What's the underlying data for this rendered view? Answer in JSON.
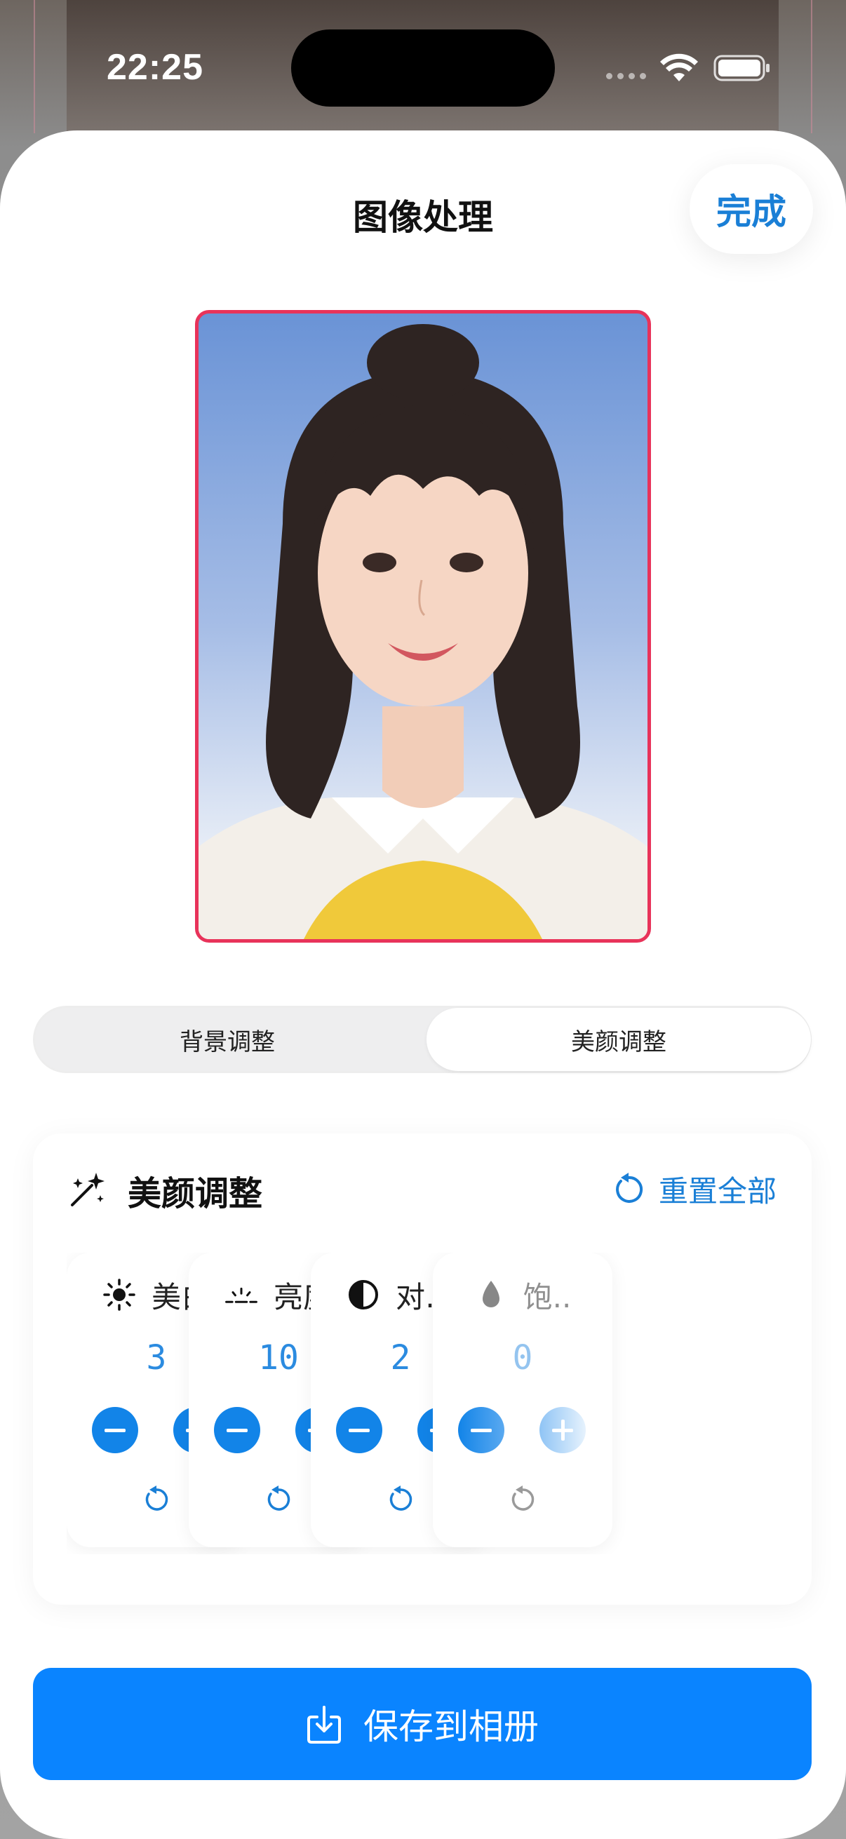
{
  "status_bar": {
    "time": "22:25"
  },
  "header": {
    "title": "图像处理",
    "done_label": "完成"
  },
  "photo": {
    "description_icon": "portrait-photo",
    "border_color": "#e8335a",
    "background_color": "#6a93d6"
  },
  "segmented": {
    "tabs": [
      {
        "label": "背景调整",
        "selected": false
      },
      {
        "label": "美颜调整",
        "selected": true
      }
    ]
  },
  "beauty_panel": {
    "title": "美颜调整",
    "reset_all_label": "重置全部",
    "cards": [
      {
        "icon": "sun-icon",
        "label": "美白",
        "value": "3"
      },
      {
        "icon": "sunrise-icon",
        "label": "亮度",
        "value": "10"
      },
      {
        "icon": "contrast-icon",
        "label": "对…",
        "value": "2"
      },
      {
        "icon": "drop-icon",
        "label": "饱..",
        "value": "0"
      }
    ]
  },
  "save_button": {
    "label": "保存到相册"
  },
  "colors": {
    "accent": "#0a84ff",
    "value_text": "#2b8be0",
    "frame": "#e8335a"
  }
}
